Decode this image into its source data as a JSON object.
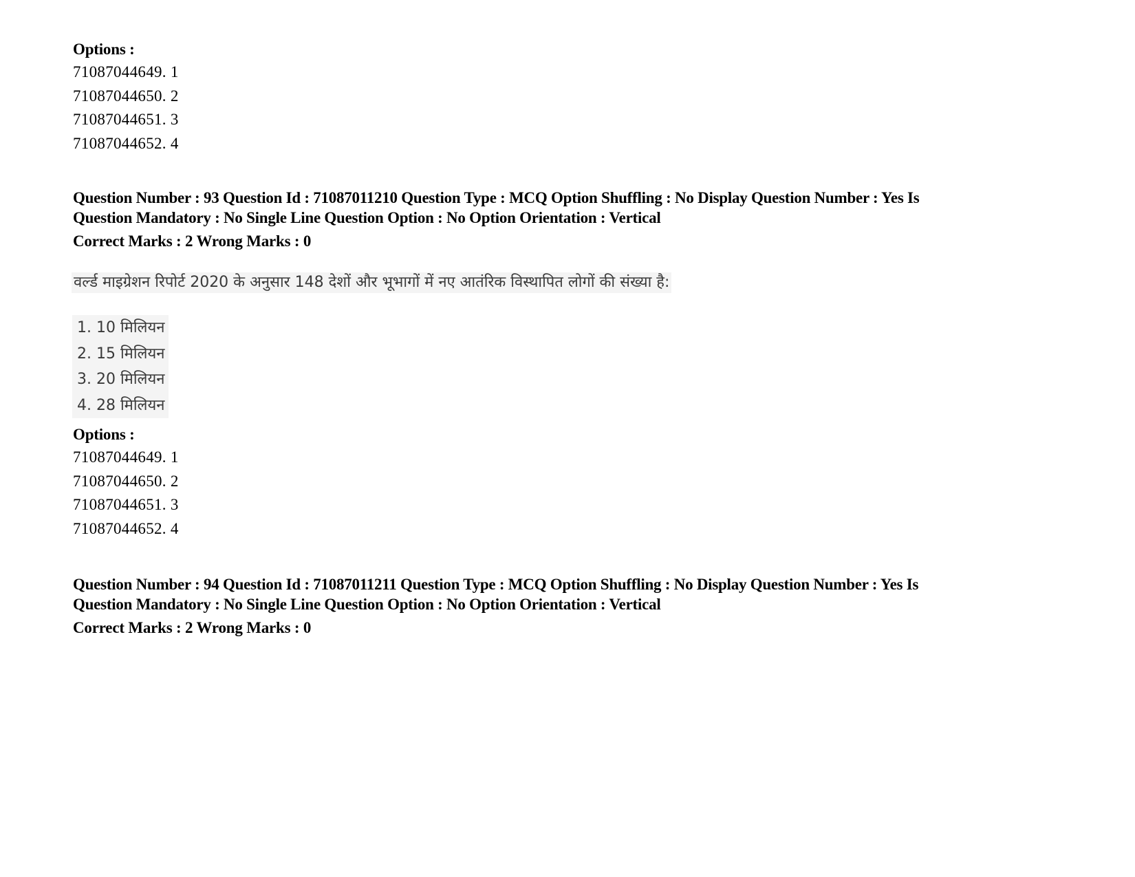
{
  "prev_question_options": {
    "label": "Options :",
    "items": [
      "71087044649. 1",
      "71087044650. 2",
      "71087044651. 3",
      "71087044652. 4"
    ]
  },
  "question_93": {
    "meta_line_1": "Question Number : 93 Question Id : 71087011210 Question Type : MCQ Option Shuffling : No Display Question Number : Yes Is",
    "meta_line_2": "Question Mandatory : No Single Line Question Option : No Option Orientation : Vertical",
    "marks": "Correct Marks : 2 Wrong Marks : 0",
    "question_text": "वर्ल्ड माइग्रेशन रिपोर्ट 2020 के अनुसार 148 देशों और भूभागों में नए आतंरिक विस्थापित लोगों की संख्या है:",
    "choices": [
      "1. 10 मिलियन",
      "2. 15 मिलियन",
      "3. 20 मिलियन",
      "4. 28 मिलियन"
    ],
    "options_label": "Options :",
    "options": [
      "71087044649. 1",
      "71087044650. 2",
      "71087044651. 3",
      "71087044652. 4"
    ]
  },
  "question_94": {
    "meta_line_1": "Question Number : 94 Question Id : 71087011211 Question Type : MCQ Option Shuffling : No Display Question Number : Yes Is",
    "meta_line_2": "Question Mandatory : No Single Line Question Option : No Option Orientation : Vertical",
    "marks": "Correct Marks : 2 Wrong Marks : 0"
  }
}
